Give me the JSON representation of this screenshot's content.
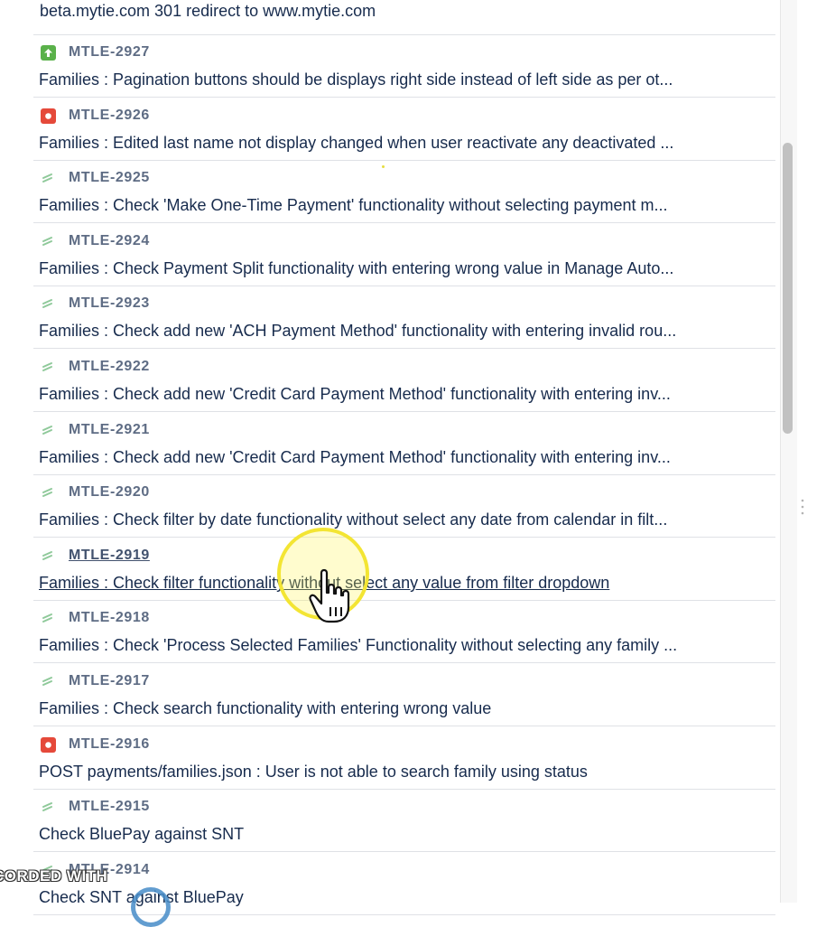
{
  "partial_top_text": "beta.mytie.com 301 redirect to www.mytie.com",
  "issues": [
    {
      "key": "MTLE-2927",
      "type": "improvement",
      "summary": "Families : Pagination buttons should be displays right side instead of left side as per ot..."
    },
    {
      "key": "MTLE-2926",
      "type": "bug",
      "summary": "Families : Edited last name not display changed when user reactivate any deactivated ..."
    },
    {
      "key": "MTLE-2925",
      "type": "subtask",
      "summary": "Families : Check 'Make One-Time Payment' functionality without selecting payment m..."
    },
    {
      "key": "MTLE-2924",
      "type": "subtask",
      "summary": "Families : Check Payment Split functionality with entering wrong value in Manage Auto..."
    },
    {
      "key": "MTLE-2923",
      "type": "subtask",
      "summary": "Families : Check add new 'ACH Payment Method' functionality with entering invalid rou..."
    },
    {
      "key": "MTLE-2922",
      "type": "subtask",
      "summary": "Families : Check add new 'Credit Card Payment Method' functionality with entering inv..."
    },
    {
      "key": "MTLE-2921",
      "type": "subtask",
      "summary": "Families : Check add new 'Credit Card Payment Method' functionality with entering inv..."
    },
    {
      "key": "MTLE-2920",
      "type": "subtask",
      "summary": "Families : Check filter by date functionality without select any date from calendar in filt..."
    },
    {
      "key": "MTLE-2919",
      "type": "subtask",
      "summary": "Families : Check filter functionality without select any value from filter dropdown"
    },
    {
      "key": "MTLE-2918",
      "type": "subtask",
      "summary": "Families : Check 'Process Selected Families' Functionality without selecting any family ..."
    },
    {
      "key": "MTLE-2917",
      "type": "subtask",
      "summary": "Families : Check search functionality with entering wrong value"
    },
    {
      "key": "MTLE-2916",
      "type": "bug",
      "summary": "POST payments/families.json : User is not able to search family using status"
    },
    {
      "key": "MTLE-2915",
      "type": "subtask",
      "summary": "Check BluePay against SNT"
    },
    {
      "key": "MTLE-2914",
      "type": "subtask",
      "summary": "Check SNT against BluePay"
    }
  ],
  "hovered_issue_index": 8,
  "watermark_text": "CORDED WITH",
  "colors": {
    "improvement": "#5ab14a",
    "bug": "#e5493a",
    "subtask_icon": "#8fc99a",
    "key_text": "#5e6c84",
    "summary_text": "#172b4d",
    "divider": "#dfe1e6",
    "click_highlight": "#f3e533"
  }
}
